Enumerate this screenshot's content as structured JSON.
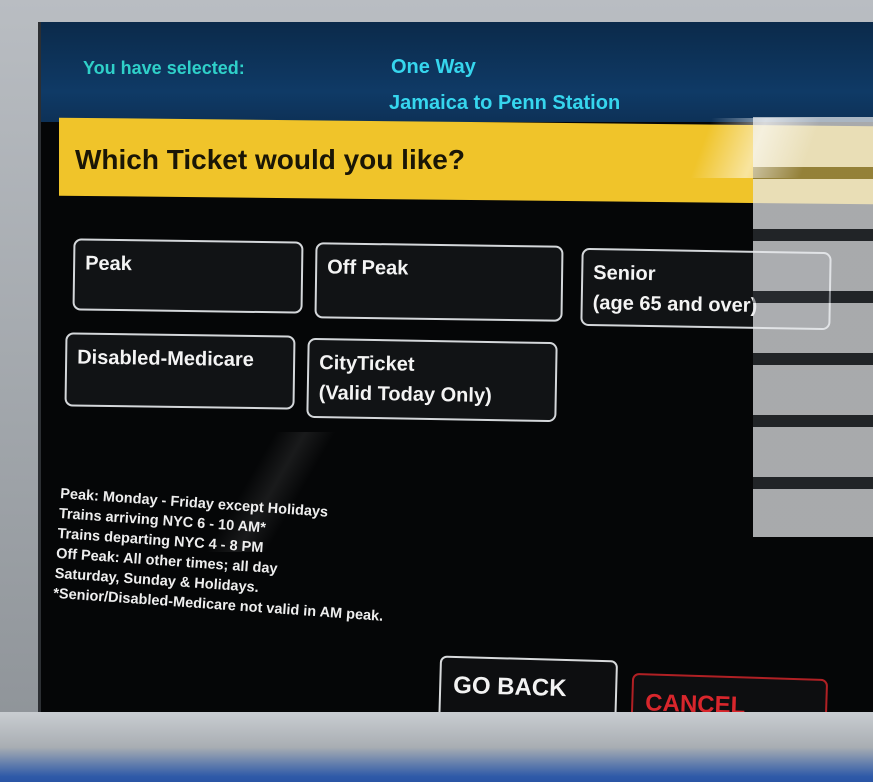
{
  "header": {
    "selected_label": "You have selected:",
    "trip_type": "One Way",
    "route": "Jamaica to Penn Station"
  },
  "prompt": {
    "question": "Which Ticket would you like?"
  },
  "tickets": [
    {
      "line1": "Peak",
      "line2": ""
    },
    {
      "line1": "Off Peak",
      "line2": ""
    },
    {
      "line1": "Senior",
      "line2": "(age 65 and over)"
    },
    {
      "line1": "Disabled-Medicare",
      "line2": ""
    },
    {
      "line1": "CityTicket",
      "line2": "(Valid Today Only)"
    }
  ],
  "notes": [
    "Peak: Monday - Friday except Holidays",
    "Trains arriving NYC 6 - 10 AM*",
    "Trains departing NYC 4 - 8 PM",
    "Off Peak: All other times; all day",
    "Saturday, Sunday & Holidays.",
    "*Senior/Disabled-Medicare not valid in AM peak."
  ],
  "navigation": {
    "go_back": "GO BACK",
    "cancel": "CANCEL"
  },
  "colors": {
    "header_bg": "#0f3a66",
    "header_text": "#36d6ee",
    "prompt_bg": "#f0c42a",
    "cancel": "#d8262c"
  }
}
